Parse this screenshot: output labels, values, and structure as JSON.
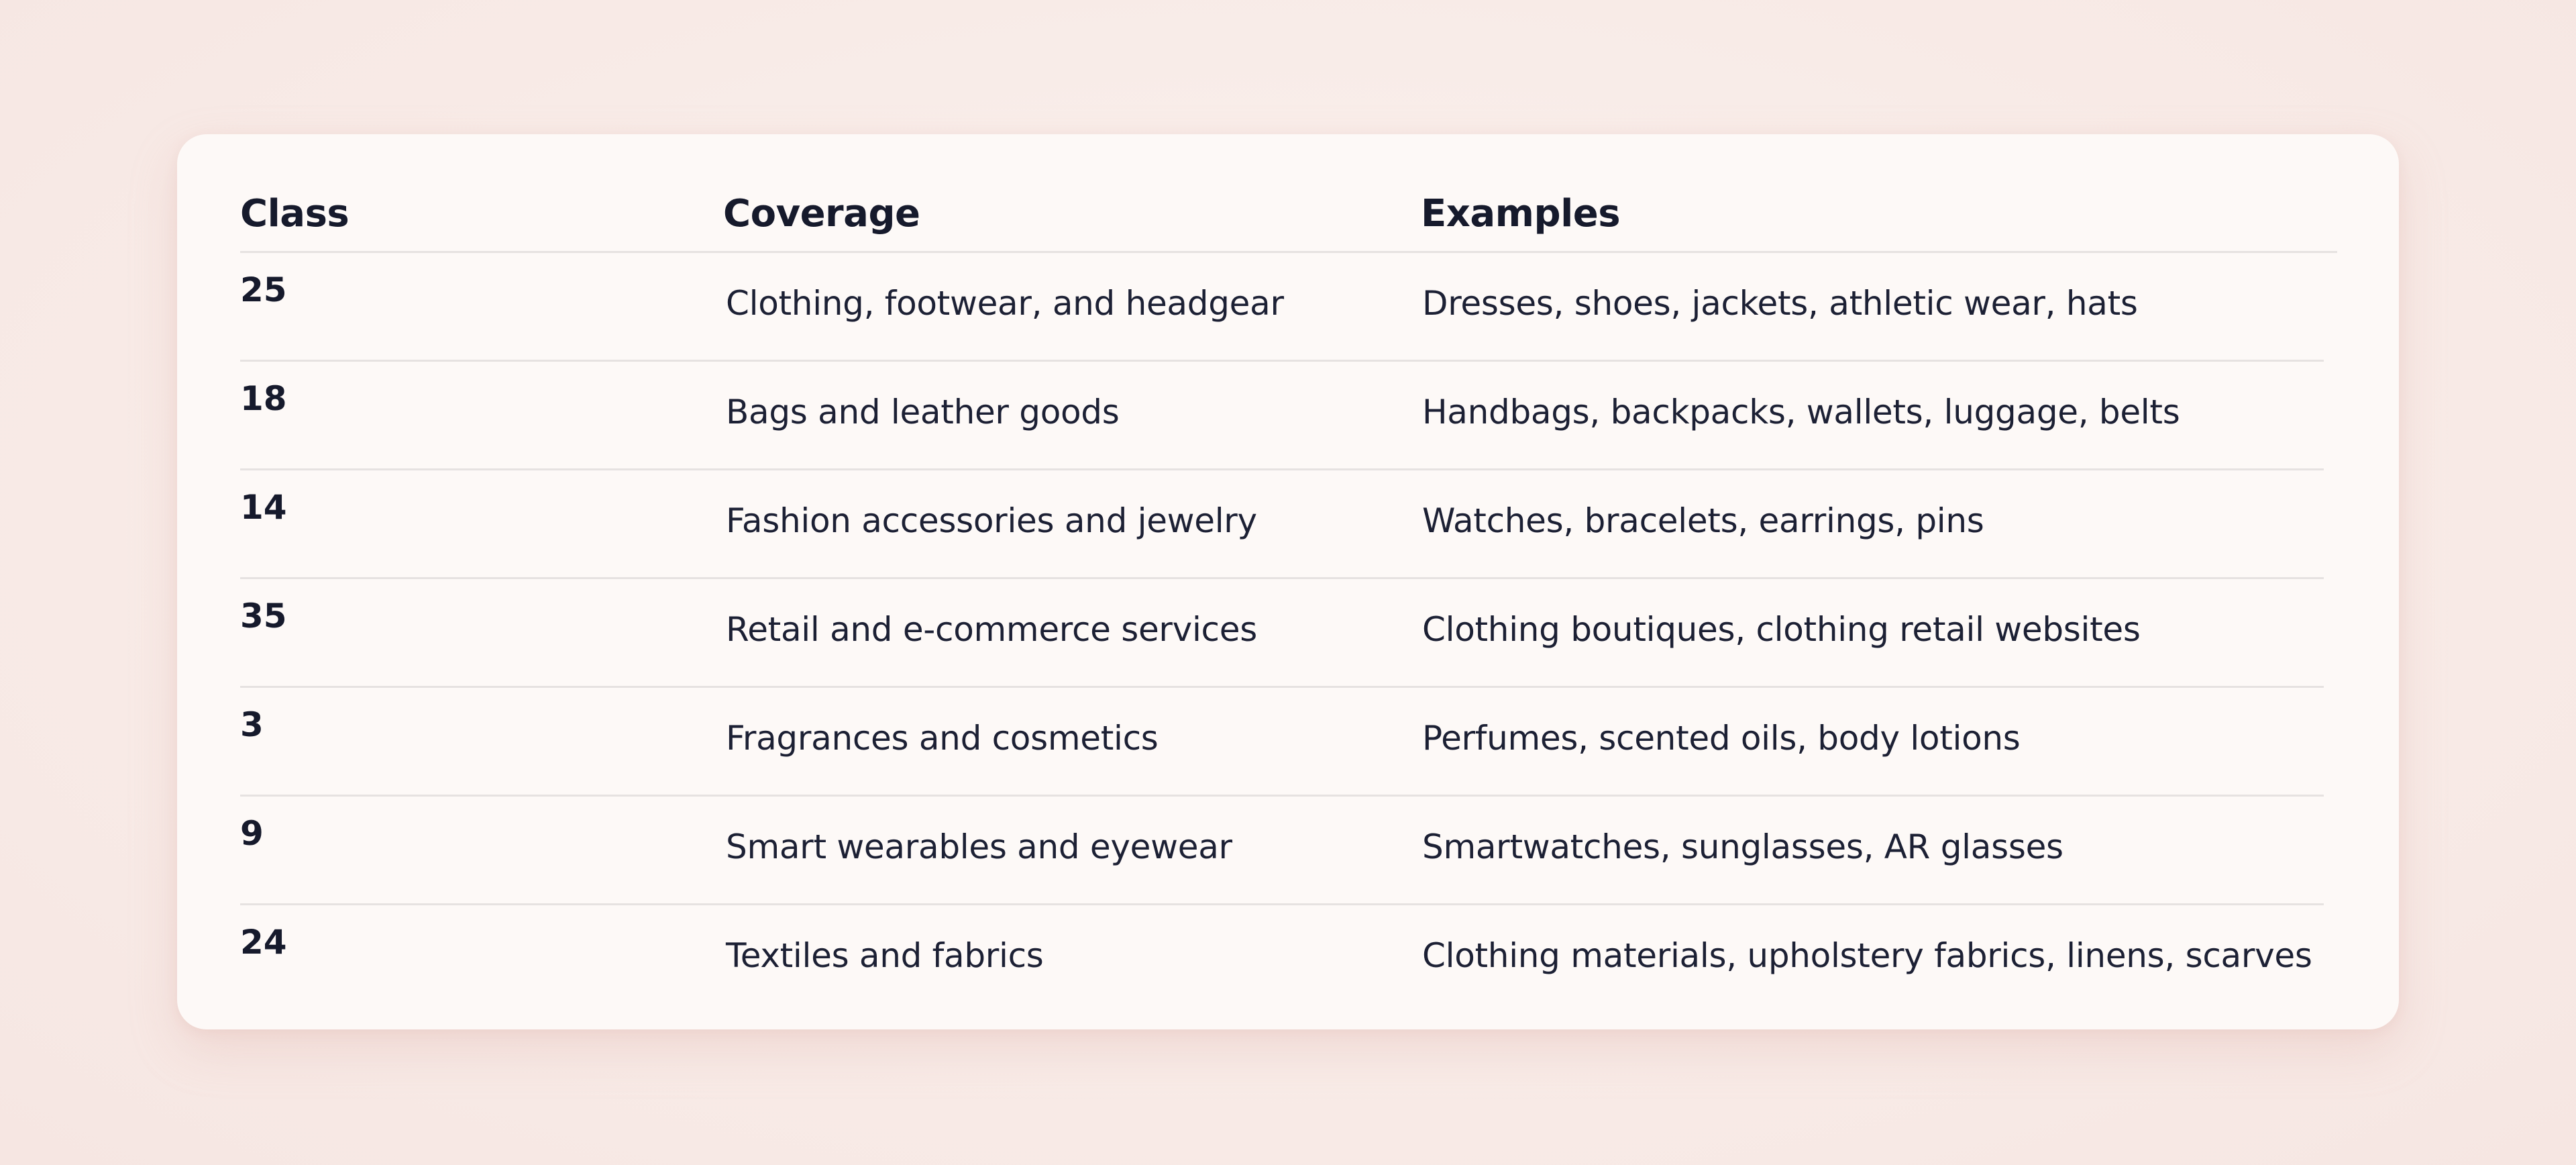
{
  "table": {
    "headers": {
      "class": "Class",
      "coverage": "Coverage",
      "examples": "Examples"
    },
    "rows": [
      {
        "class": "25",
        "coverage": "Clothing, footwear, and headgear",
        "examples": "Dresses, shoes, jackets, athletic wear, hats"
      },
      {
        "class": "18",
        "coverage": "Bags and leather goods",
        "examples": "Handbags, backpacks, wallets, luggage, belts"
      },
      {
        "class": "14",
        "coverage": "Fashion accessories and jewelry",
        "examples": "Watches, bracelets, earrings, pins"
      },
      {
        "class": "35",
        "coverage": "Retail and e-commerce services",
        "examples": "Clothing boutiques, clothing retail websites"
      },
      {
        "class": "3",
        "coverage": "Fragrances and cosmetics",
        "examples": "Perfumes, scented oils, body lotions"
      },
      {
        "class": "9",
        "coverage": "Smart wearables and eyewear",
        "examples": "Smartwatches, sunglasses, AR glasses"
      },
      {
        "class": "24",
        "coverage": "Textiles and fabrics",
        "examples": "Clothing materials, upholstery fabrics, linens, scarves"
      }
    ]
  }
}
